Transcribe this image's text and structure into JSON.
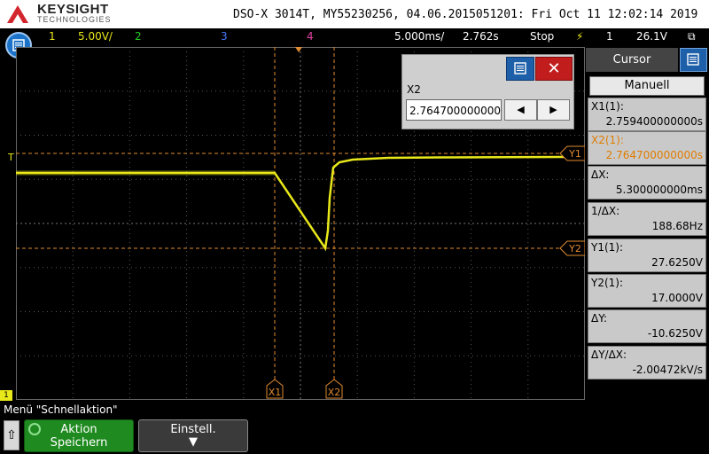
{
  "brand": {
    "name": "KEYSIGHT",
    "sub": "TECHNOLOGIES"
  },
  "device_info": "DSO-X 3014T, MY55230256, 04.06.2015051201: Fri Oct 11 12:02:14 2019",
  "channels": {
    "ch1_label": "1",
    "ch1_scale": "5.00V/",
    "ch2_label": "2",
    "ch3_label": "3",
    "ch4_label": "4",
    "timebase": "5.000ms/",
    "delay": "2.762s",
    "run_state": "Stop",
    "trigger_source": "1",
    "trigger_level": "26.1V",
    "colors": {
      "ch1": "#e8e81a",
      "ch2": "#22cc22",
      "ch3": "#4a78ff",
      "ch4": "#e040a0",
      "cursor": "#e08a30"
    }
  },
  "markers": {
    "trigger_level": "T",
    "ground_ref": "1",
    "x1": "X1",
    "x2": "X2",
    "y1": "Y1",
    "y2": "Y2"
  },
  "dialog": {
    "label": "X2",
    "value": "2.764700000000s",
    "left_icon": "left-arrow-icon",
    "right_icon": "right-arrow-icon"
  },
  "panel": {
    "title": "Cursor",
    "mode": "Manuell",
    "rows": [
      {
        "label": "X1(1):",
        "value": "2.759400000000s",
        "orange": false
      },
      {
        "label": "X2(1):",
        "value": "2.764700000000s",
        "orange": true
      },
      {
        "label": "ΔX:",
        "value": "5.300000000ms",
        "orange": false
      },
      {
        "label": "1/ΔX:",
        "value": "188.68Hz",
        "orange": false
      },
      {
        "label": "Y1(1):",
        "value": "27.6250V",
        "orange": false
      },
      {
        "label": "Y2(1):",
        "value": "17.0000V",
        "orange": false
      },
      {
        "label": "ΔY:",
        "value": "-10.6250V",
        "orange": false
      },
      {
        "label": "ΔY/ΔX:",
        "value": "-2.00472kV/s",
        "orange": false
      }
    ]
  },
  "softkeys": {
    "menu_title": "Menü \"Schnellaktion\"",
    "aktion_line1": "Aktion",
    "aktion_line2": "Speichern",
    "einstell": "Einstell."
  }
}
